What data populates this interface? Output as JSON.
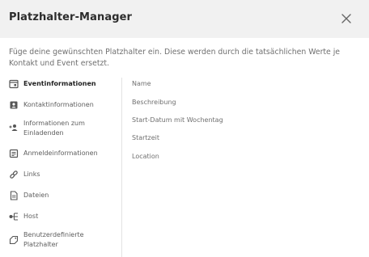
{
  "dialog": {
    "title": "Platzhalter-Manager",
    "intro": "Füge deine gewünschten Platzhalter ein. Diese werden durch die tatsächlichen Werte je Kontakt und Event ersetzt."
  },
  "nav": {
    "items": [
      {
        "label": "Eventinformationen",
        "icon": "calendar-card-icon",
        "active": true
      },
      {
        "label": "Kontaktinformationen",
        "icon": "contact-card-icon"
      },
      {
        "label": "Informationen zum Einladenden",
        "icon": "person-add-icon"
      },
      {
        "label": "Anmeldeinformationen",
        "icon": "form-list-icon"
      },
      {
        "label": "Links",
        "icon": "link-icon"
      },
      {
        "label": "Dateien",
        "icon": "document-icon"
      },
      {
        "label": "Host",
        "icon": "host-icon"
      },
      {
        "label": "Benutzerdefinierte Platzhalter",
        "icon": "tag-icon"
      }
    ]
  },
  "placeholders": [
    "Name",
    "Beschreibung",
    "Start-Datum mit Wochentag",
    "Startzeit",
    "Location"
  ],
  "colors": {
    "header_bg": "#f1f1f1",
    "divider": "#e3e3e3",
    "icon": "#555555"
  }
}
